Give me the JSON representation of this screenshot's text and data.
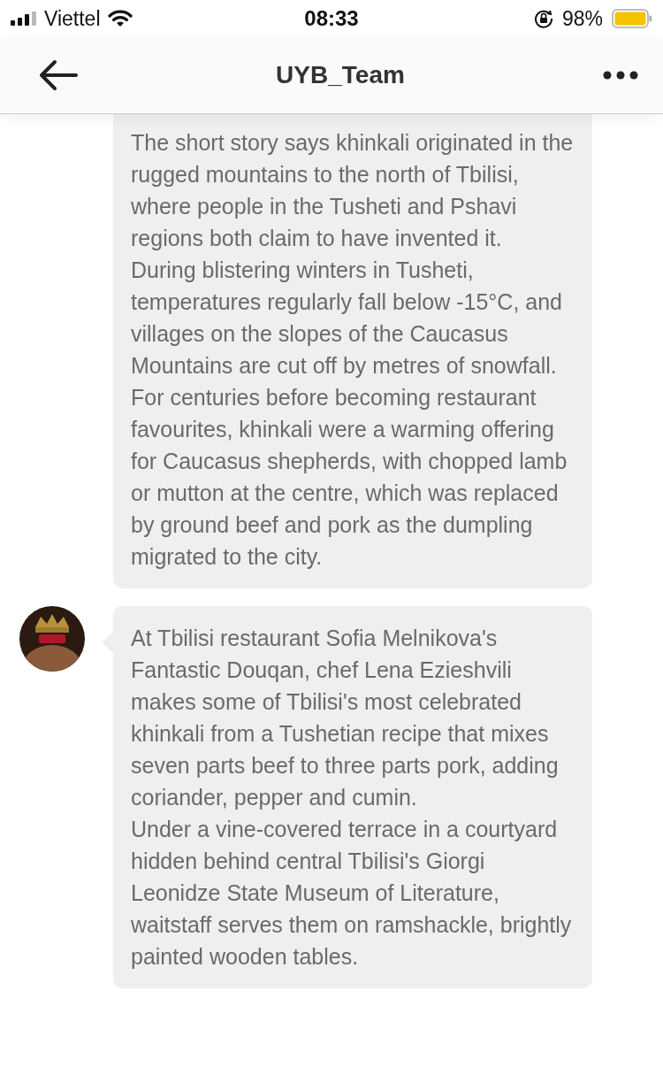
{
  "status_bar": {
    "carrier": "Viettel",
    "time": "08:33",
    "battery_text": "98%"
  },
  "header": {
    "title": "UYB_Team"
  },
  "messages": [
    {
      "avatar": false,
      "continued": true,
      "paragraphs": [
        "The short story says khinkali originated in the rugged mountains to the north of Tbilisi, where people in the Tusheti and Pshavi regions both claim to have invented it.",
        "During blistering winters in Tusheti, temperatures regularly fall below -15°C, and villages on the slopes of the Caucasus Mountains are cut off by metres of snowfall. For centuries before becoming restaurant favourites, khinkali were a warming offering for Caucasus shepherds, with chopped lamb or mutton at the centre, which was replaced by ground beef and pork as the dumpling migrated to the city."
      ]
    },
    {
      "avatar": true,
      "continued": false,
      "paragraphs": [
        "At Tbilisi restaurant Sofia Melnikova's Fantastic Douqan, chef Lena Ezieshvili makes some of Tbilisi's most celebrated khinkali from a Tushetian recipe that mixes seven parts beef to three parts pork, adding coriander, pepper and cumin.",
        "Under a vine-covered terrace in a courtyard hidden behind central Tbilisi's Giorgi Leonidze State Museum of Literature, waitstaff serves them on ramshackle, brightly painted wooden tables."
      ]
    }
  ]
}
